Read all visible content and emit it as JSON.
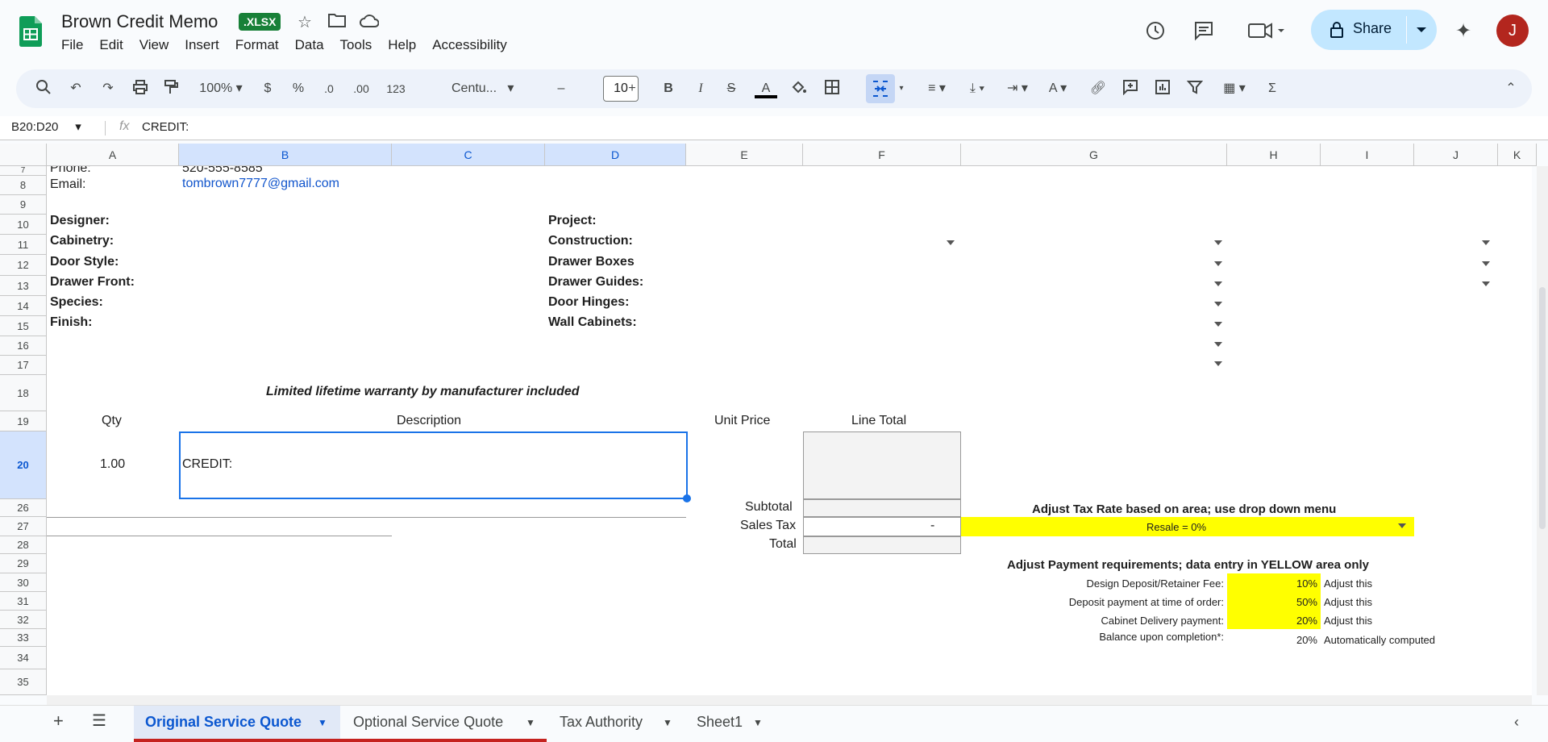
{
  "app": {
    "doc_title": "Brown Credit Memo",
    "file_badge": ".XLSX",
    "menu": [
      "File",
      "Edit",
      "View",
      "Insert",
      "Format",
      "Data",
      "Tools",
      "Help",
      "Accessibility"
    ],
    "share_label": "Share",
    "avatar_initial": "J"
  },
  "toolbar": {
    "zoom": "100%",
    "currency": "$",
    "percent": "%",
    "dec_decrease": ".0",
    "dec_increase": ".00",
    "number_format": "123",
    "font": "Centu...",
    "font_size": "10",
    "bold": "B",
    "italic": "I",
    "strike": "S",
    "text_color": "A",
    "minus": "–",
    "plus": "+"
  },
  "formula_bar": {
    "name_box": "B20:D20",
    "fx": "fx",
    "content": "CREDIT:"
  },
  "columns": [
    "A",
    "B",
    "C",
    "D",
    "E",
    "F",
    "G",
    "H",
    "I",
    "J",
    "K"
  ],
  "rows": [
    "7",
    "8",
    "9",
    "10",
    "11",
    "12",
    "13",
    "14",
    "15",
    "16",
    "17",
    "18",
    "19",
    "20",
    "26",
    "27",
    "28",
    "29",
    "30",
    "31",
    "32",
    "33",
    "34",
    "35"
  ],
  "contact": {
    "phone_label": "Phone:",
    "phone_value": "520-555-8585",
    "email_label": "Email:",
    "email_value": "tombrown7777@gmail.com"
  },
  "left_labels": [
    "Designer:",
    "Cabinetry:",
    "Door Style:",
    "Drawer Front:",
    "Species:",
    "Finish:"
  ],
  "right_labels": [
    "Project:",
    "Construction:",
    "Drawer Boxes",
    "Drawer Guides:",
    "Door Hinges:",
    "Wall Cabinets:"
  ],
  "warranty": "Limited lifetime warranty by manufacturer included",
  "table_headers": {
    "qty": "Qty",
    "description": "Description",
    "unit_price": "Unit Price",
    "line_total": "Line Total"
  },
  "line_item": {
    "qty": "1.00",
    "description": "CREDIT:"
  },
  "totals": {
    "subtotal": "Subtotal",
    "sales_tax": "Sales Tax",
    "sales_tax_value": "-",
    "total": "Total"
  },
  "tax_note": "Adjust Tax Rate based on area; use drop down menu",
  "tax_select": "Resale = 0%",
  "payment_note": "Adjust Payment requirements; data entry in YELLOW area only",
  "payments": [
    {
      "label": "Design Deposit/Retainer Fee:",
      "value": "10%",
      "note": "Adjust this"
    },
    {
      "label": "Deposit payment at time of order:",
      "value": "50%",
      "note": "Adjust this"
    },
    {
      "label": "Cabinet Delivery payment:",
      "value": "20%",
      "note": "Adjust this"
    },
    {
      "label": "Balance upon completion*:",
      "value": "20%",
      "note": "Automatically computed"
    }
  ],
  "sheets": [
    "Original Service Quote",
    "Optional Service Quote",
    "Tax Authority",
    "Sheet1"
  ],
  "colors": {
    "accent": "#0b57d0",
    "green": "#188038",
    "yellow": "#ffff00",
    "tab_underline": "#c5221f"
  }
}
